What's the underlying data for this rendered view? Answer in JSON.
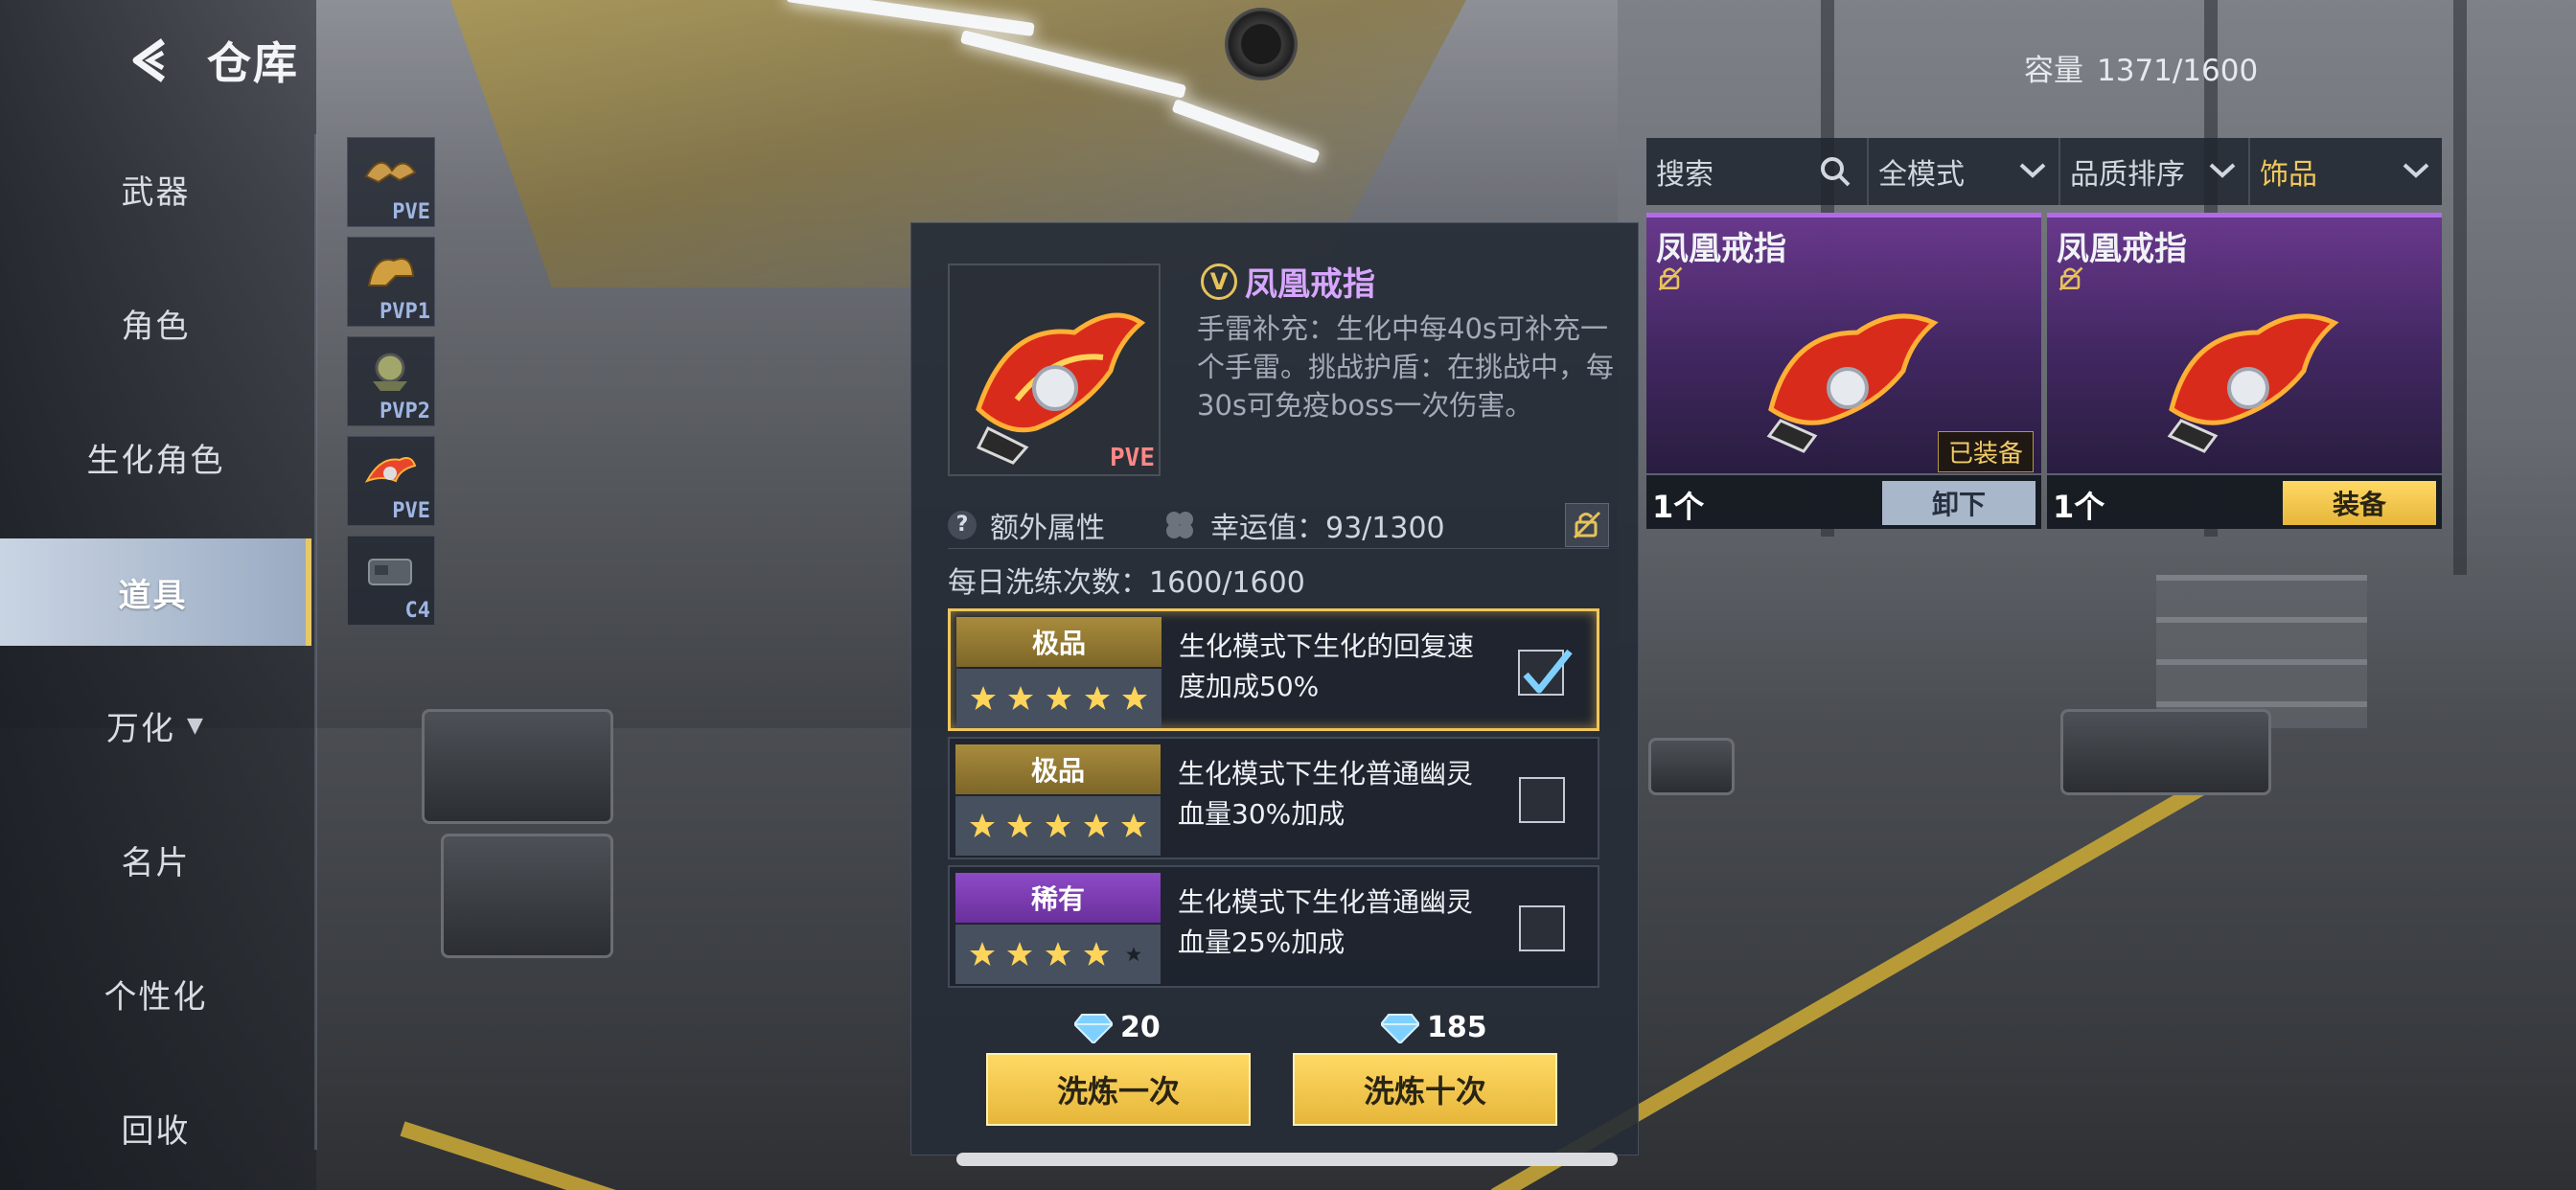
{
  "header": {
    "title": "仓库"
  },
  "capacity": {
    "label": "容量",
    "value": "1371/1600"
  },
  "sidebar": {
    "items": [
      {
        "label": "武器"
      },
      {
        "label": "角色"
      },
      {
        "label": "生化角色"
      },
      {
        "label": "道具",
        "active": true
      },
      {
        "label": "万化",
        "caret": "▼"
      },
      {
        "label": "名片"
      },
      {
        "label": "个性化"
      },
      {
        "label": "回收"
      }
    ]
  },
  "thumbs": [
    {
      "tag": "PVE"
    },
    {
      "tag": "PVP1"
    },
    {
      "tag": "PVP2"
    },
    {
      "tag": "PVE"
    },
    {
      "tag": "C4"
    }
  ],
  "detail": {
    "badge": "V",
    "name": "凤凰戒指",
    "image_tag": "PVE",
    "desc": "手雷补充：生化中每40s可补充一个手雷。挑战护盾：在挑战中，每30s可免疫boss一次伤害。",
    "extra_attr_label": "额外属性",
    "luck_label": "幸运值：93/1300",
    "daily_label": "每日洗练次数：1600/1600",
    "options": [
      {
        "grade": "极品",
        "grade_color": "#a88b3c",
        "stars": 5,
        "max_stars": 5,
        "text": "生化模式下生化的回复速度加成50%",
        "checked": true
      },
      {
        "grade": "极品",
        "grade_color": "#a88b3c",
        "stars": 5,
        "max_stars": 5,
        "text": "生化模式下生化普通幽灵血量30%加成",
        "checked": false
      },
      {
        "grade": "稀有",
        "grade_color": "#8d4bc6",
        "stars": 4,
        "max_stars": 5,
        "text": "生化模式下生化普通幽灵血量25%加成",
        "checked": false
      }
    ],
    "refine_once": {
      "cost": "20",
      "label": "洗炼一次"
    },
    "refine_ten": {
      "cost": "185",
      "label": "洗炼十次"
    }
  },
  "filters": {
    "search_placeholder": "搜索",
    "mode": "全模式",
    "sort": "品质排序",
    "category": "饰品"
  },
  "cards": [
    {
      "name": "凤凰戒指",
      "equipped_label": "已装备",
      "count": "1个",
      "button": "卸下"
    },
    {
      "name": "凤凰戒指",
      "count": "1个",
      "button": "装备"
    }
  ],
  "colors": {
    "accent_gold": "#f0c65b",
    "epic_purple": "#b26be8",
    "name_purple": "#d7a6ff"
  }
}
